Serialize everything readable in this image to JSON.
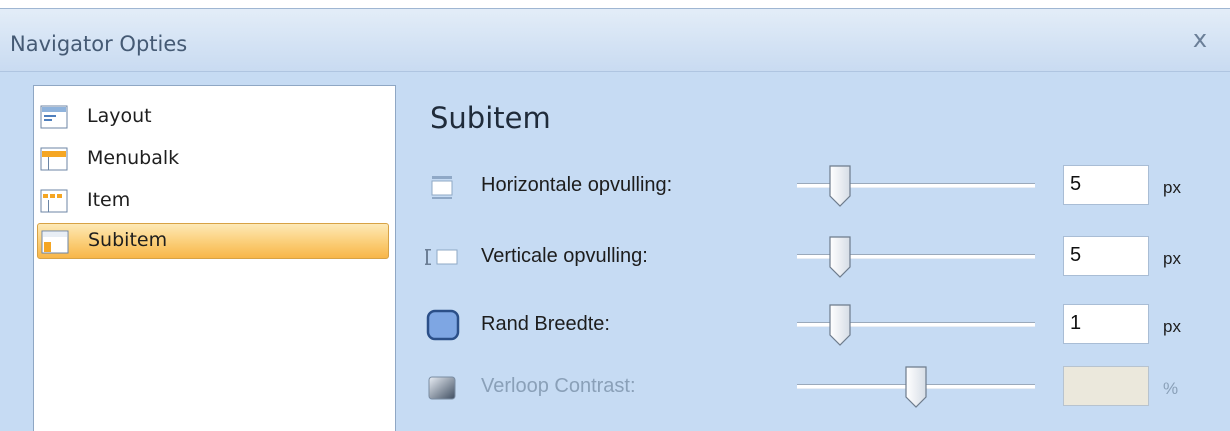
{
  "window": {
    "title": "Navigator Opties",
    "close_symbol": "x"
  },
  "nav": {
    "items": [
      {
        "label": "Layout",
        "icon": "layout-icon",
        "selected": false
      },
      {
        "label": "Menubalk",
        "icon": "menubar-icon",
        "selected": false
      },
      {
        "label": "Item",
        "icon": "item-icon",
        "selected": false
      },
      {
        "label": "Subitem",
        "icon": "subitem-icon",
        "selected": true
      }
    ]
  },
  "panel": {
    "heading": "Subitem",
    "rows": [
      {
        "label": "Horizontale opvulling:",
        "value": "5",
        "unit": "px",
        "slider_level": 0.14,
        "enabled": true,
        "icon": "horizontal-padding-icon"
      },
      {
        "label": "Verticale opvulling:",
        "value": "5",
        "unit": "px",
        "slider_level": 0.14,
        "enabled": true,
        "icon": "vertical-padding-icon"
      },
      {
        "label": "Rand Breedte:",
        "value": "1",
        "unit": "px",
        "slider_level": 0.14,
        "enabled": true,
        "icon": "border-width-icon"
      },
      {
        "label": "Verloop Contrast:",
        "value": "",
        "unit": "%",
        "slider_level": 0.5,
        "enabled": false,
        "icon": "gradient-contrast-icon"
      }
    ]
  },
  "colors": {
    "accent": "#f8b648",
    "window_bg": "#c6dbf3",
    "disabled_text": "#8aa0b8"
  }
}
